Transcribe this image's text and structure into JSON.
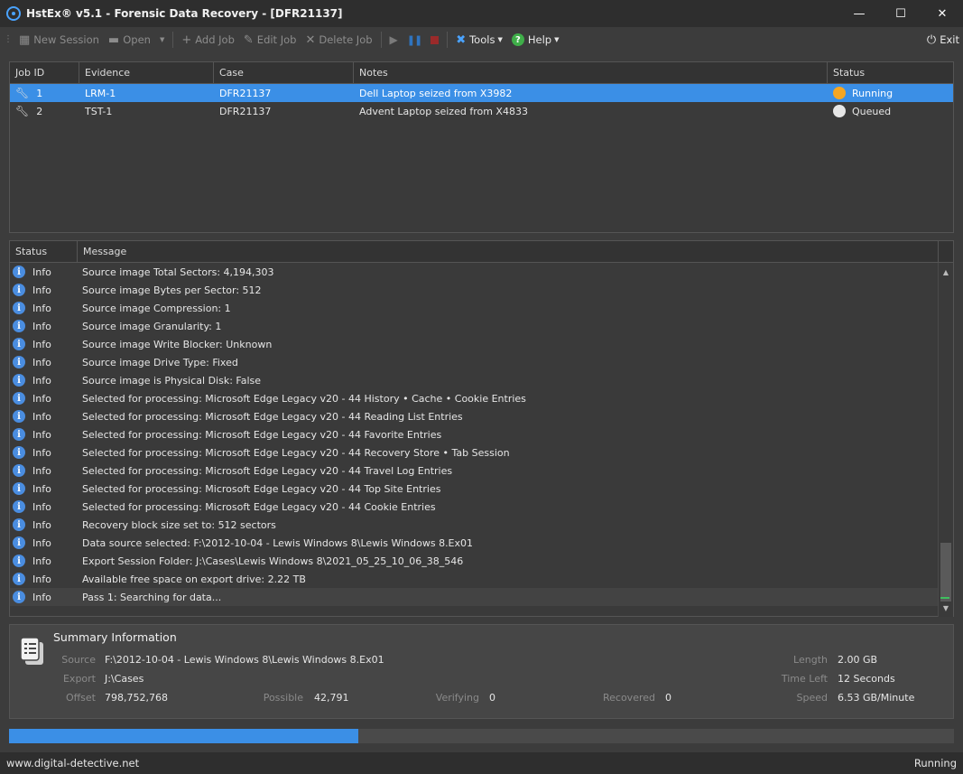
{
  "window": {
    "title": "HstEx® v5.1 - Forensic Data Recovery - [DFR21137]",
    "minimize": "—",
    "maximize": "☐",
    "close": "✕"
  },
  "toolbar": {
    "new_session": "New Session",
    "open": "Open",
    "add_job": "Add Job",
    "edit_job": "Edit Job",
    "delete_job": "Delete Job",
    "tools": "Tools",
    "help": "Help",
    "exit": "Exit",
    "icons": {
      "new_session": "new-session-icon",
      "open": "folder-icon",
      "add_job": "plus-icon",
      "edit_job": "pencil-icon",
      "delete_job": "x-icon",
      "play": "play-icon",
      "pause": "pause-icon",
      "stop": "stop-icon",
      "tools": "tools-icon",
      "help": "help-icon",
      "exit": "power-icon"
    }
  },
  "jobs": {
    "columns": [
      "Job ID",
      "Evidence",
      "Case",
      "Notes",
      "Status"
    ],
    "rows": [
      {
        "id": "1",
        "evidence": "LRM-1",
        "case": "DFR21137",
        "notes": "Dell Laptop seized from X3982",
        "status": "Running",
        "status_color": "#f5a623",
        "selected": true
      },
      {
        "id": "2",
        "evidence": "TST-1",
        "case": "DFR21137",
        "notes": "Advent Laptop seized from X4833",
        "status": "Queued",
        "status_color": "#e6e6e6",
        "selected": false
      }
    ]
  },
  "log": {
    "columns": [
      "Status",
      "Message"
    ],
    "rows": [
      {
        "status": "Info",
        "message": "Source image Total Sectors: 4,194,303"
      },
      {
        "status": "Info",
        "message": "Source image Bytes per Sector: 512"
      },
      {
        "status": "Info",
        "message": "Source image Compression: 1"
      },
      {
        "status": "Info",
        "message": "Source image Granularity: 1"
      },
      {
        "status": "Info",
        "message": "Source image Write Blocker: Unknown"
      },
      {
        "status": "Info",
        "message": "Source image Drive Type: Fixed"
      },
      {
        "status": "Info",
        "message": "Source image is Physical Disk: False"
      },
      {
        "status": "Info",
        "message": "Selected for processing: Microsoft Edge Legacy v20 - 44 History • Cache • Cookie Entries"
      },
      {
        "status": "Info",
        "message": "Selected for processing: Microsoft Edge Legacy v20 - 44 Reading List Entries"
      },
      {
        "status": "Info",
        "message": "Selected for processing: Microsoft Edge Legacy v20 - 44 Favorite Entries"
      },
      {
        "status": "Info",
        "message": "Selected for processing: Microsoft Edge Legacy v20 - 44 Recovery Store • Tab Session"
      },
      {
        "status": "Info",
        "message": "Selected for processing: Microsoft Edge Legacy v20 - 44 Travel Log Entries"
      },
      {
        "status": "Info",
        "message": "Selected for processing: Microsoft Edge Legacy v20 - 44 Top Site Entries"
      },
      {
        "status": "Info",
        "message": "Selected for processing: Microsoft Edge Legacy v20 - 44 Cookie Entries"
      },
      {
        "status": "Info",
        "message": "Recovery block size set to: 512 sectors"
      },
      {
        "status": "Info",
        "message": "Data source selected: F:\\2012-10-04 - Lewis Windows 8\\Lewis Windows 8.Ex01"
      },
      {
        "status": "Info",
        "message": "Export Session Folder: J:\\Cases\\Lewis Windows 8\\2021_05_25_10_06_38_546"
      },
      {
        "status": "Info",
        "message": "Available free space on export drive: 2.22 TB"
      },
      {
        "status": "Info",
        "message": "Pass 1: Searching for data..."
      }
    ]
  },
  "summary": {
    "title": "Summary Information",
    "source_label": "Source",
    "source_value": "F:\\2012-10-04 - Lewis Windows 8\\Lewis Windows 8.Ex01",
    "export_label": "Export",
    "export_value": "J:\\Cases",
    "offset_label": "Offset",
    "offset_value": "798,752,768",
    "possible_label": "Possible",
    "possible_value": "42,791",
    "verifying_label": "Verifying",
    "verifying_value": "0",
    "recovered_label": "Recovered",
    "recovered_value": "0",
    "length_label": "Length",
    "length_value": "2.00 GB",
    "time_left_label": "Time Left",
    "time_left_value": "12 Seconds",
    "speed_label": "Speed",
    "speed_value": "6.53 GB/Minute"
  },
  "progress": {
    "fraction": 0.37,
    "color": "#3b8fe6"
  },
  "statusbar": {
    "website": "www.digital-detective.net",
    "state": "Running"
  }
}
